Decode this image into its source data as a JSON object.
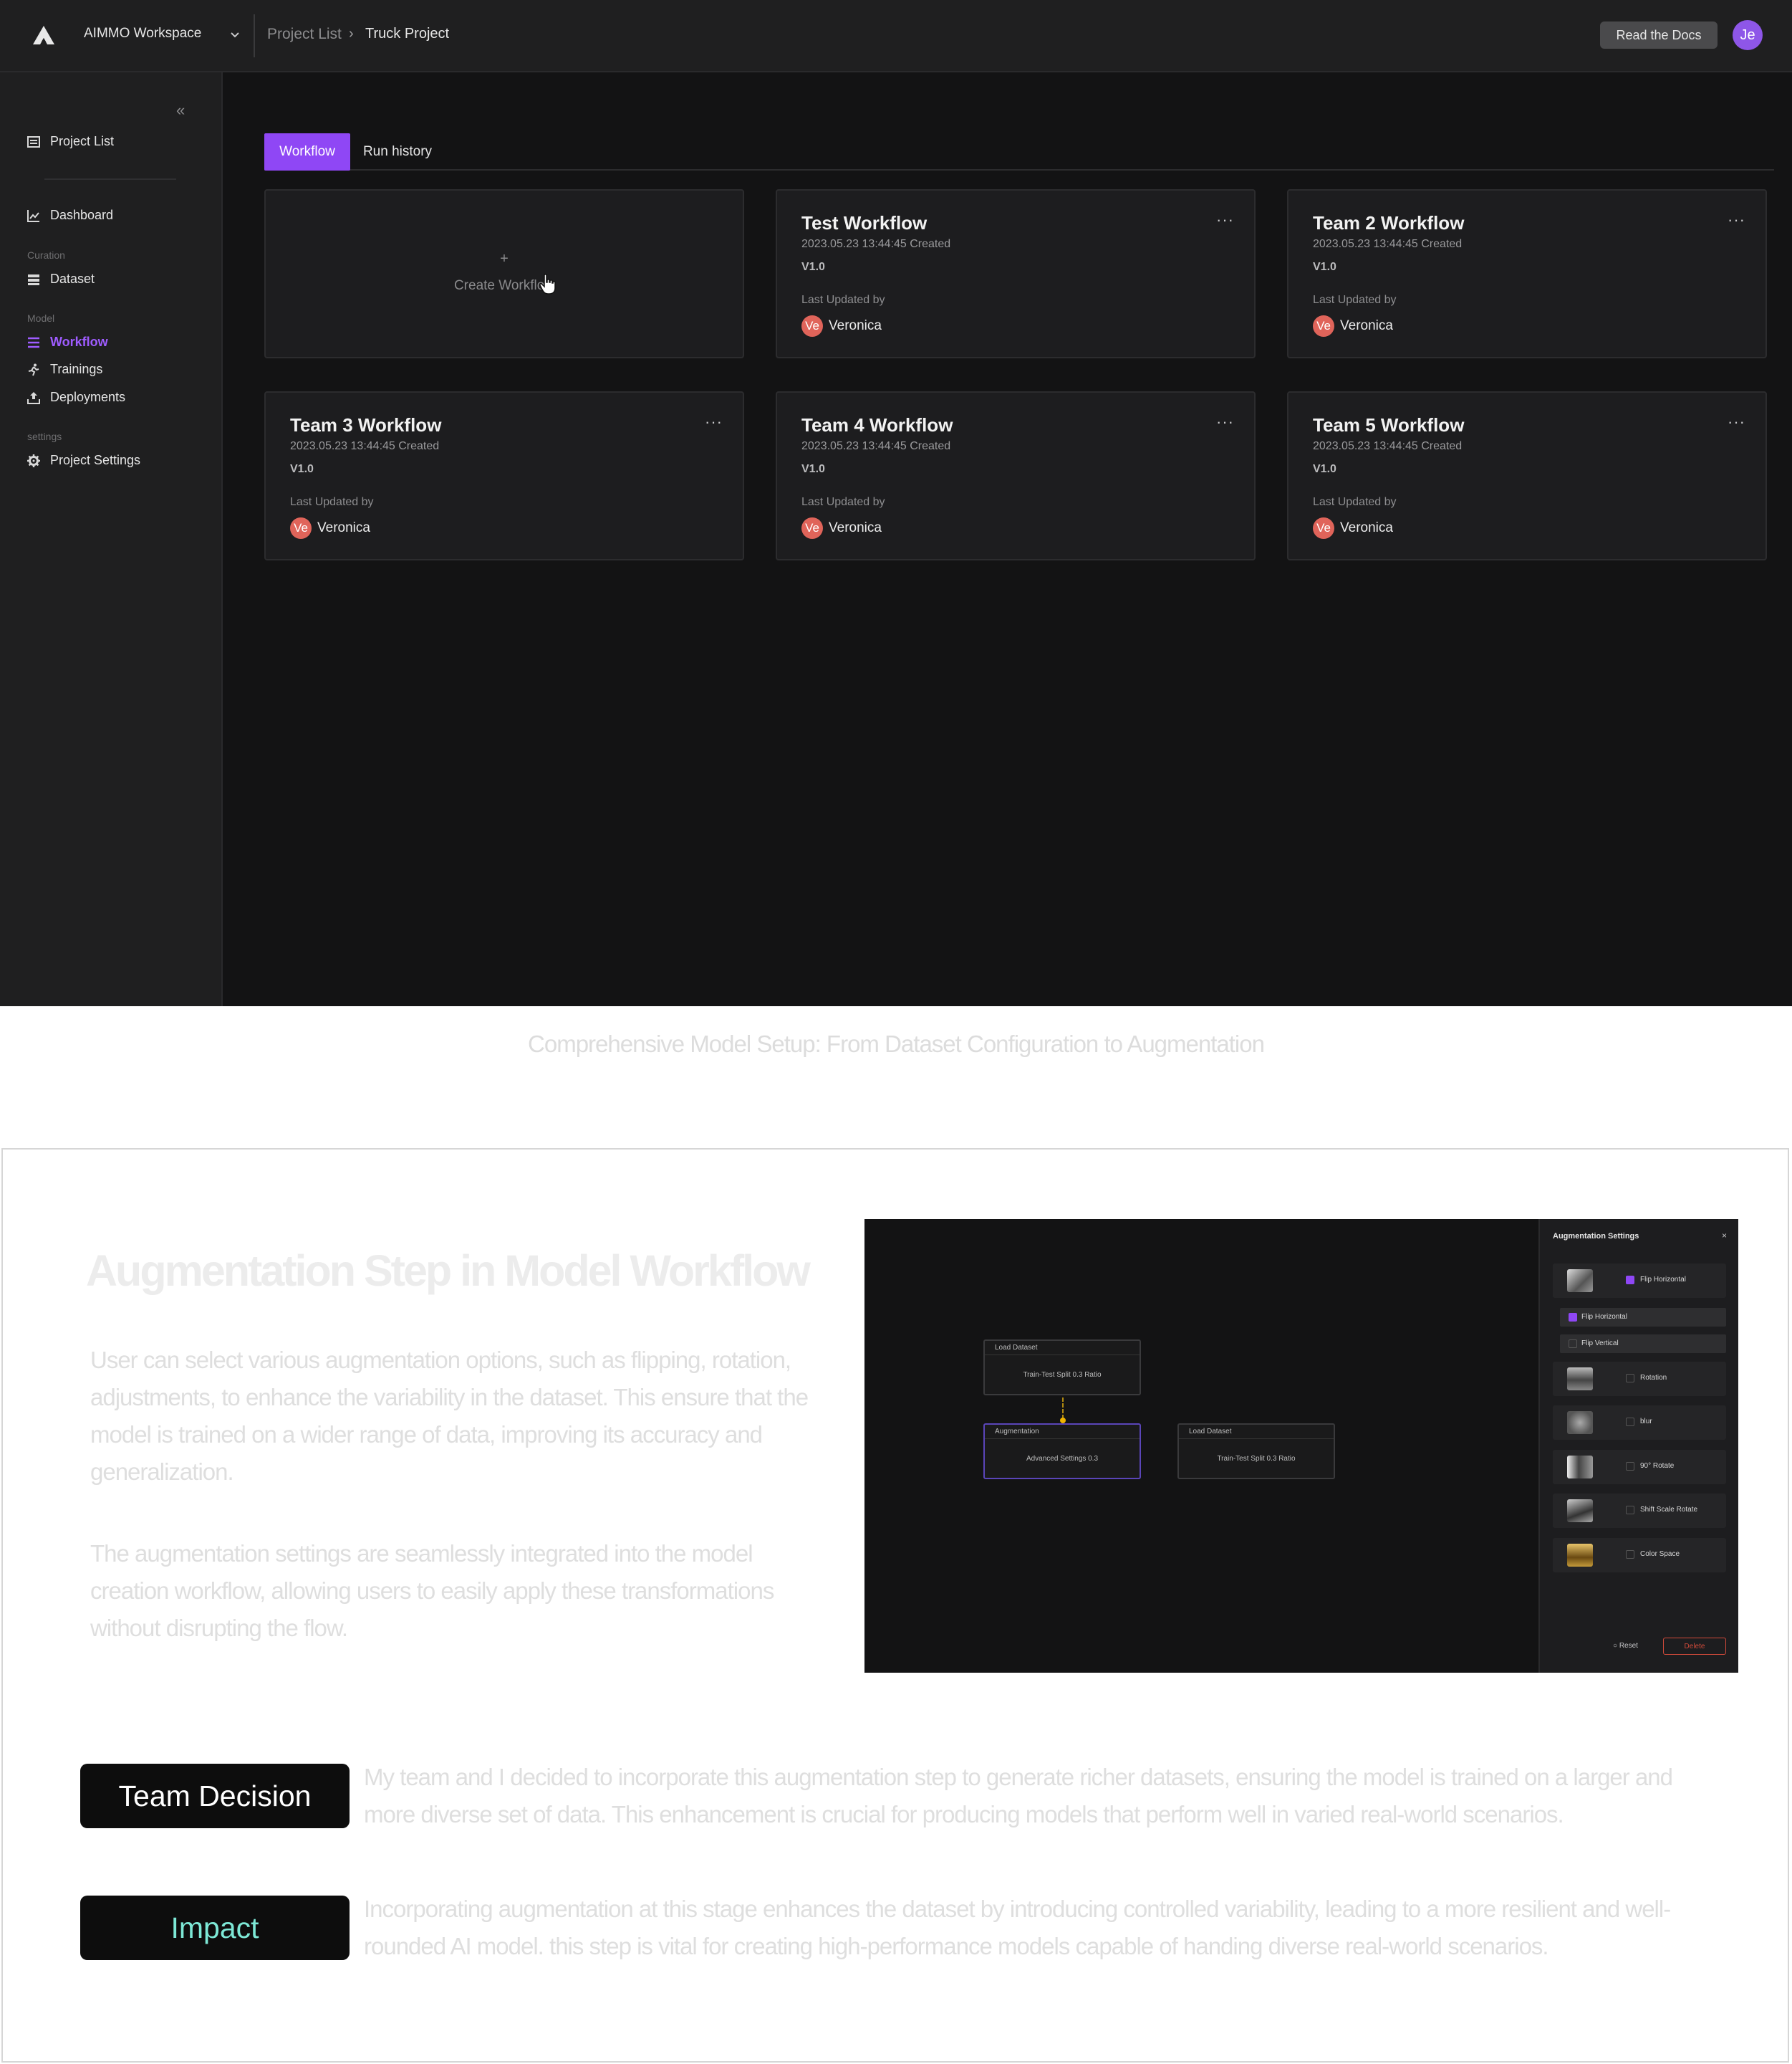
{
  "header": {
    "workspace": "AIMMO Workspace",
    "breadcrumb": [
      "Project List",
      "Truck Project"
    ],
    "breadcrumb_separator": "›",
    "docs_button": "Read the Docs",
    "user_initials": "Je"
  },
  "sidebar": {
    "collapse_glyph": "«",
    "project_list": "Project List",
    "dashboard": "Dashboard",
    "sections": {
      "curation": "Curation",
      "model": "Model",
      "settings": "settings"
    },
    "dataset": "Dataset",
    "workflow": "Workflow",
    "trainings": "Trainings",
    "deployments": "Deployments",
    "project_settings": "Project Settings"
  },
  "tabs": [
    "Workflow",
    "Run history"
  ],
  "create_card": {
    "plus": "+",
    "label": "Create Workflow"
  },
  "cards": [
    {
      "title": "Test Workflow",
      "date": "2023.05.23 13:44:45 Created",
      "version": "V1.0",
      "updated_label": "Last Updated by",
      "avatar": "Ve",
      "user": "Veronica"
    },
    {
      "title": "Team 2 Workflow",
      "date": "2023.05.23 13:44:45 Created",
      "version": "V1.0",
      "updated_label": "Last Updated by",
      "avatar": "Ve",
      "user": "Veronica"
    },
    {
      "title": "Team 3 Workflow",
      "date": "2023.05.23 13:44:45 Created",
      "version": "V1.0",
      "updated_label": "Last Updated by",
      "avatar": "Ve",
      "user": "Veronica"
    },
    {
      "title": "Team 4 Workflow",
      "date": "2023.05.23 13:44:45 Created",
      "version": "V1.0",
      "updated_label": "Last Updated by",
      "avatar": "Ve",
      "user": "Veronica"
    },
    {
      "title": "Team 5 Workflow",
      "date": "2023.05.23 13:44:45 Created",
      "version": "V1.0",
      "updated_label": "Last Updated by",
      "avatar": "Ve",
      "user": "Veronica"
    }
  ],
  "card_menu_glyph": "···",
  "caption": "Comprehensive Model Setup: From Dataset Configuration to Augmentation",
  "augmentation": {
    "title": "Augmentation Step in Model Workflow",
    "paragraph1": " User can select various augmentation options, such as flipping, rotation, adjustments, to enhance the variability in the dataset. This ensure that the model is trained on a wider range of data, improving its accuracy and generalization.",
    "paragraph2": "The augmentation settings are seamlessly integrated into the model creation workflow, allowing users to easily apply these transformations without disrupting the flow."
  },
  "mini_screen": {
    "nodes": [
      {
        "head": "Load Dataset",
        "body": "Train-Test Split 0.3 Ratio"
      },
      {
        "head": "Augmentation",
        "body": "Advanced Settings 0.3"
      },
      {
        "head": "Load Dataset",
        "body": "Train-Test Split 0.3 Ratio"
      }
    ],
    "panel_title": "Augmentation Settings",
    "close_glyph": "×",
    "options": [
      {
        "label": "Flip Horizontal",
        "checked": true
      },
      {
        "label": "Rotation",
        "checked": false
      },
      {
        "label": "blur",
        "checked": false
      },
      {
        "label": "90° Rotate",
        "checked": false
      },
      {
        "label": "Shift Scale Rotate",
        "checked": false
      },
      {
        "label": "Color Space",
        "checked": false
      }
    ],
    "sub_options": [
      {
        "label": "Flip Horizontal",
        "checked": true
      },
      {
        "label": "Flip Vertical",
        "checked": false
      }
    ],
    "reset": "○  Reset",
    "delete": "Delete"
  },
  "team_decision": {
    "label": "Team Decision",
    "text": "My team and I decided to incorporate this augmentation step to generate richer datasets, ensuring the model is trained on a larger and more diverse set of data. This enhancement is crucial for producing models that perform well in varied real-world scenarios."
  },
  "impact": {
    "label": "Impact",
    "text": "Incorporating augmentation at this stage enhances the dataset by introducing controlled variability, leading to a more resilient and well-rounded AI model. this step is vital for creating high-performance models capable of handing diverse real-world scenarios."
  },
  "colors": {
    "accent": "#8f47f5",
    "app_bg": "#131314",
    "panel_bg": "#1f1f20",
    "avatar_user": "#e0645a",
    "impact_text": "#7de8d6"
  }
}
